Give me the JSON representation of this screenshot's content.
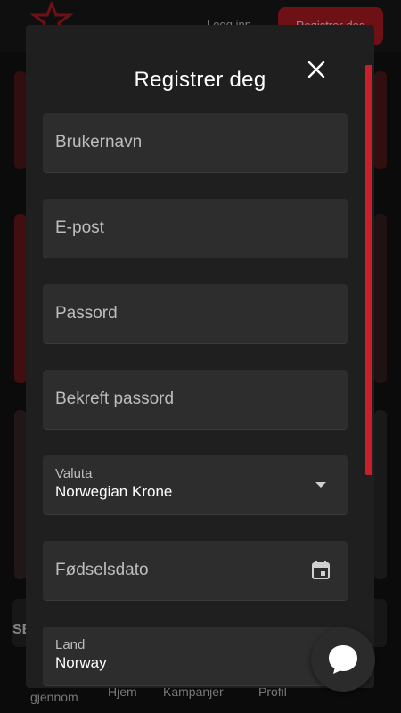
{
  "header": {
    "login_label": "Logg inn",
    "register_label": "Registrer deg"
  },
  "background": {
    "strip_text": "SE"
  },
  "bottom_nav": {
    "items": [
      {
        "label": "gjennom"
      },
      {
        "label": "Hjem"
      },
      {
        "label": "Kampanjer"
      },
      {
        "label": "Profil"
      }
    ]
  },
  "modal": {
    "title": "Registrer deg",
    "close_icon": "close-icon",
    "fields": {
      "username": {
        "placeholder": "Brukernavn"
      },
      "email": {
        "placeholder": "E-post"
      },
      "password": {
        "placeholder": "Passord"
      },
      "confirm_password": {
        "placeholder": "Bekreft passord"
      },
      "currency": {
        "label": "Valuta",
        "value": "Norwegian Krone"
      },
      "birthdate": {
        "placeholder": "Fødselsdato"
      },
      "country": {
        "label": "Land",
        "value": "Norway"
      }
    }
  },
  "colors": {
    "accent": "#c8202a",
    "modal_bg": "#1f1f1f",
    "field_bg": "#2d2d2d"
  }
}
